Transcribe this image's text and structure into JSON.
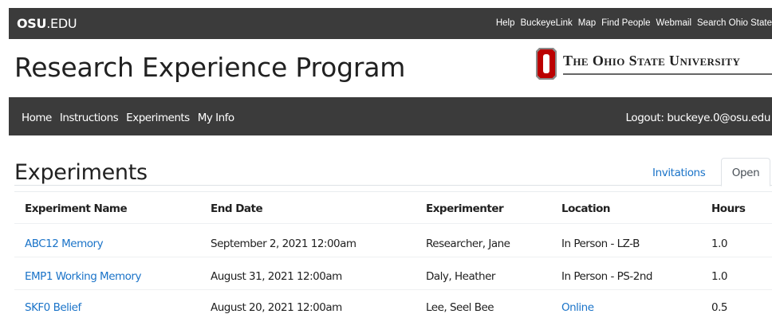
{
  "topbar": {
    "logo_bold": "OSU",
    "logo_rest": ".EDU",
    "links": [
      "Help",
      "BuckeyeLink",
      "Map",
      "Find People",
      "Webmail",
      "Search Ohio State"
    ]
  },
  "site_title": "Research Experience Program",
  "university_name": "The Ohio State University",
  "nav": {
    "links": [
      "Home",
      "Instructions",
      "Experiments",
      "My Info"
    ],
    "logout": "Logout: buckeye.0@osu.edu"
  },
  "page": {
    "heading": "Experiments",
    "tabs": {
      "invitations": "Invitations",
      "open": "Open"
    }
  },
  "table": {
    "headers": [
      "Experiment Name",
      "End Date",
      "Experimenter",
      "Location",
      "Hours"
    ],
    "rows": [
      {
        "name": "ABC12 Memory",
        "end_date": "September 2, 2021 12:00am",
        "experimenter": "Researcher, Jane",
        "location": "In Person - LZ-B",
        "hours": "1.0"
      },
      {
        "name": "EMP1 Working Memory",
        "end_date": "August 31, 2021 12:00am",
        "experimenter": "Daly, Heather",
        "location": "In Person - PS-2nd",
        "hours": "1.0"
      },
      {
        "name": "SKF0 Belief",
        "end_date": "August 20, 2021 12:00am",
        "experimenter": "Lee, Seel Bee",
        "location": "Online",
        "hours": "0.5"
      }
    ]
  },
  "colors": {
    "bar": "#3b3b3b",
    "link": "#1a73c8",
    "scarlet": "#bb0000"
  }
}
